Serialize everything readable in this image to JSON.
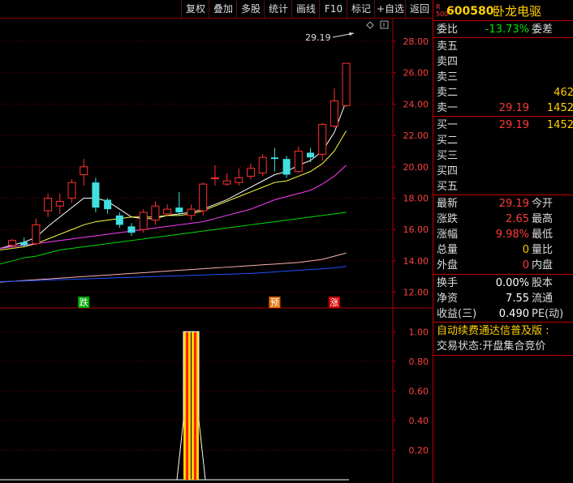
{
  "toolbar": {
    "buttons": [
      "复权",
      "叠加",
      "多股",
      "统计",
      "画线",
      "F10",
      "标记",
      "+自选",
      "返回"
    ]
  },
  "chart": {
    "price_axis": [
      "28.00",
      "26.00",
      "24.00",
      "22.00",
      "20.00",
      "18.00",
      "16.00",
      "14.00",
      "12.00"
    ],
    "indicator_axis": [
      "1.00",
      "0.80",
      "0.60",
      "0.40",
      "0.20"
    ],
    "high_label": "29.19",
    "signals": [
      {
        "text": "跌",
        "color": "#00aa00"
      },
      {
        "text": "预",
        "color": "#e07000"
      },
      {
        "text": "涨",
        "color": "#d00000"
      }
    ],
    "marker_icon": "diamond-icon",
    "settings_icon": "settings-icon"
  },
  "chart_data": {
    "type": "candlestick",
    "price_ylim": [
      11.0,
      29.5
    ],
    "indicator_ylim": [
      0,
      1.1
    ],
    "candles": [
      {
        "o": 15.0,
        "h": 15.4,
        "l": 14.8,
        "c": 15.3
      },
      {
        "o": 15.2,
        "h": 15.5,
        "l": 14.9,
        "c": 15.0
      },
      {
        "o": 15.1,
        "h": 16.7,
        "l": 15.0,
        "c": 16.3
      },
      {
        "o": 17.2,
        "h": 18.3,
        "l": 16.8,
        "c": 18.0
      },
      {
        "o": 17.5,
        "h": 18.3,
        "l": 17.0,
        "c": 17.8
      },
      {
        "o": 18.0,
        "h": 19.2,
        "l": 17.7,
        "c": 19.0
      },
      {
        "o": 19.5,
        "h": 20.5,
        "l": 18.8,
        "c": 20.0
      },
      {
        "o": 19.0,
        "h": 19.3,
        "l": 17.1,
        "c": 17.4
      },
      {
        "o": 17.9,
        "h": 18.0,
        "l": 17.0,
        "c": 17.3
      },
      {
        "o": 16.9,
        "h": 17.1,
        "l": 16.1,
        "c": 16.3
      },
      {
        "o": 16.2,
        "h": 16.4,
        "l": 15.6,
        "c": 15.8
      },
      {
        "o": 16.0,
        "h": 17.3,
        "l": 15.8,
        "c": 17.1
      },
      {
        "o": 16.6,
        "h": 17.8,
        "l": 16.3,
        "c": 17.5
      },
      {
        "o": 17.0,
        "h": 17.6,
        "l": 16.9,
        "c": 17.3
      },
      {
        "o": 17.4,
        "h": 18.4,
        "l": 16.9,
        "c": 17.1
      },
      {
        "o": 16.9,
        "h": 17.6,
        "l": 16.6,
        "c": 17.3
      },
      {
        "o": 17.2,
        "h": 19.0,
        "l": 16.9,
        "c": 18.9
      },
      {
        "o": 19.3,
        "h": 20.1,
        "l": 18.8,
        "c": 19.3
      },
      {
        "o": 18.9,
        "h": 19.6,
        "l": 18.8,
        "c": 19.1
      },
      {
        "o": 19.0,
        "h": 19.9,
        "l": 18.8,
        "c": 19.3
      },
      {
        "o": 19.4,
        "h": 20.2,
        "l": 19.2,
        "c": 19.9
      },
      {
        "o": 19.6,
        "h": 20.8,
        "l": 19.4,
        "c": 20.6
      },
      {
        "o": 20.6,
        "h": 21.2,
        "l": 19.7,
        "c": 20.5
      },
      {
        "o": 20.5,
        "h": 20.7,
        "l": 19.3,
        "c": 19.5
      },
      {
        "o": 19.7,
        "h": 21.3,
        "l": 19.6,
        "c": 21.0
      },
      {
        "o": 20.9,
        "h": 21.2,
        "l": 20.3,
        "c": 20.6
      },
      {
        "o": 20.8,
        "h": 22.8,
        "l": 20.4,
        "c": 22.7
      },
      {
        "o": 22.6,
        "h": 25.0,
        "l": 22.5,
        "c": 24.2
      },
      {
        "o": 23.9,
        "h": 26.6,
        "l": 23.8,
        "c": 26.6
      }
    ],
    "ma_lines": [
      {
        "color": "#ffffff",
        "values": [
          15.0,
          15.2,
          15.5,
          16.2,
          16.8,
          17.4,
          18.0,
          18.0,
          17.8,
          17.3,
          16.8,
          16.7,
          16.7,
          16.9,
          17.0,
          17.1,
          17.3,
          17.6,
          17.9,
          18.3,
          18.7,
          19.1,
          19.5,
          19.7,
          20.1,
          20.4,
          21.0,
          22.2,
          24.2
        ]
      },
      {
        "color": "#ffff40",
        "values": [
          14.8,
          14.9,
          15.1,
          15.4,
          15.7,
          16.0,
          16.3,
          16.5,
          16.6,
          16.7,
          16.8,
          16.8,
          16.8,
          16.9,
          16.9,
          17.0,
          17.2,
          17.5,
          17.8,
          18.1,
          18.4,
          18.7,
          19.0,
          19.1,
          19.4,
          19.7,
          20.2,
          21.0,
          22.3
        ]
      },
      {
        "color": "#ff40ff",
        "values": [
          14.9,
          15.0,
          15.1,
          15.2,
          15.3,
          15.4,
          15.5,
          15.6,
          15.7,
          15.8,
          15.9,
          16.0,
          16.1,
          16.2,
          16.3,
          16.4,
          16.5,
          16.7,
          16.9,
          17.1,
          17.3,
          17.6,
          17.9,
          18.1,
          18.3,
          18.5,
          18.9,
          19.4,
          20.1
        ]
      },
      {
        "color": "#00dd00",
        "values": [
          14.0,
          14.2,
          14.3,
          14.5,
          14.7,
          14.8,
          14.9,
          15.0,
          15.1,
          15.2,
          15.3,
          15.4,
          15.5,
          15.6,
          15.7,
          15.8,
          15.9,
          16.0,
          16.1,
          16.2,
          16.3,
          16.4,
          16.5,
          16.6,
          16.7,
          16.8,
          16.9,
          17.0,
          17.1
        ]
      },
      {
        "color": "#ffb0b0",
        "values": [
          12.7,
          12.75,
          12.8,
          12.85,
          12.9,
          12.95,
          13.0,
          13.05,
          13.1,
          13.15,
          13.2,
          13.25,
          13.3,
          13.35,
          13.4,
          13.45,
          13.5,
          13.55,
          13.6,
          13.65,
          13.7,
          13.75,
          13.8,
          13.85,
          13.9,
          14.0,
          14.1,
          14.3,
          14.5
        ]
      },
      {
        "color": "#2050ff",
        "values": [
          12.7,
          12.72,
          12.75,
          12.78,
          12.8,
          12.83,
          12.85,
          12.88,
          12.9,
          12.93,
          12.95,
          12.98,
          13.0,
          13.03,
          13.05,
          13.08,
          13.1,
          13.13,
          13.15,
          13.18,
          13.2,
          13.25,
          13.3,
          13.35,
          13.4,
          13.45,
          13.5,
          13.55,
          13.65
        ]
      }
    ],
    "indicator_values": [
      0,
      0,
      0,
      0,
      0,
      0,
      0,
      0,
      0,
      0,
      0,
      0,
      0,
      0,
      0,
      0,
      1.0,
      1.0,
      0,
      0,
      0,
      0,
      0,
      0,
      0,
      0,
      0,
      0,
      0
    ]
  },
  "quote": {
    "code_prefix": "R\n500",
    "code": "600580",
    "name": "卧龙电驱",
    "weibi_label": "委比",
    "weibi_value": "-13.73%",
    "weicha_label": "委差",
    "asks": [
      {
        "label": "卖五",
        "price": "",
        "vol": ""
      },
      {
        "label": "卖四",
        "price": "",
        "vol": ""
      },
      {
        "label": "卖三",
        "price": "",
        "vol": ""
      },
      {
        "label": "卖二",
        "price": "",
        "vol": "462"
      },
      {
        "label": "卖一",
        "price": "29.19",
        "vol": "1452"
      }
    ],
    "bids": [
      {
        "label": "买一",
        "price": "29.19",
        "vol": "1452"
      },
      {
        "label": "买二",
        "price": "",
        "vol": ""
      },
      {
        "label": "买三",
        "price": "",
        "vol": ""
      },
      {
        "label": "买四",
        "price": "",
        "vol": ""
      },
      {
        "label": "买五",
        "price": "",
        "vol": ""
      }
    ],
    "stats": [
      {
        "l1": "最新",
        "v1": "29.19",
        "c1": "red",
        "l2": "今开"
      },
      {
        "l1": "涨跌",
        "v1": "2.65",
        "c1": "red",
        "l2": "最高"
      },
      {
        "l1": "涨幅",
        "v1": "9.98%",
        "c1": "red",
        "l2": "最低"
      },
      {
        "l1": "总量",
        "v1": "0",
        "c1": "yellow",
        "l2": "量比"
      },
      {
        "l1": "外盘",
        "v1": "0",
        "c1": "red",
        "l2": "内盘"
      }
    ],
    "fin": [
      {
        "l1": "换手",
        "v1": "0.00%",
        "l2": "股本"
      },
      {
        "l1": "净资",
        "v1": "7.55",
        "l2": "流通"
      },
      {
        "l1": "收益(三)",
        "v1": "0.490",
        "l2": "PE(动)"
      }
    ],
    "ticker": "自动续费通达信普及版 :",
    "trade_status": "交易状态:开盘集合竞价"
  }
}
